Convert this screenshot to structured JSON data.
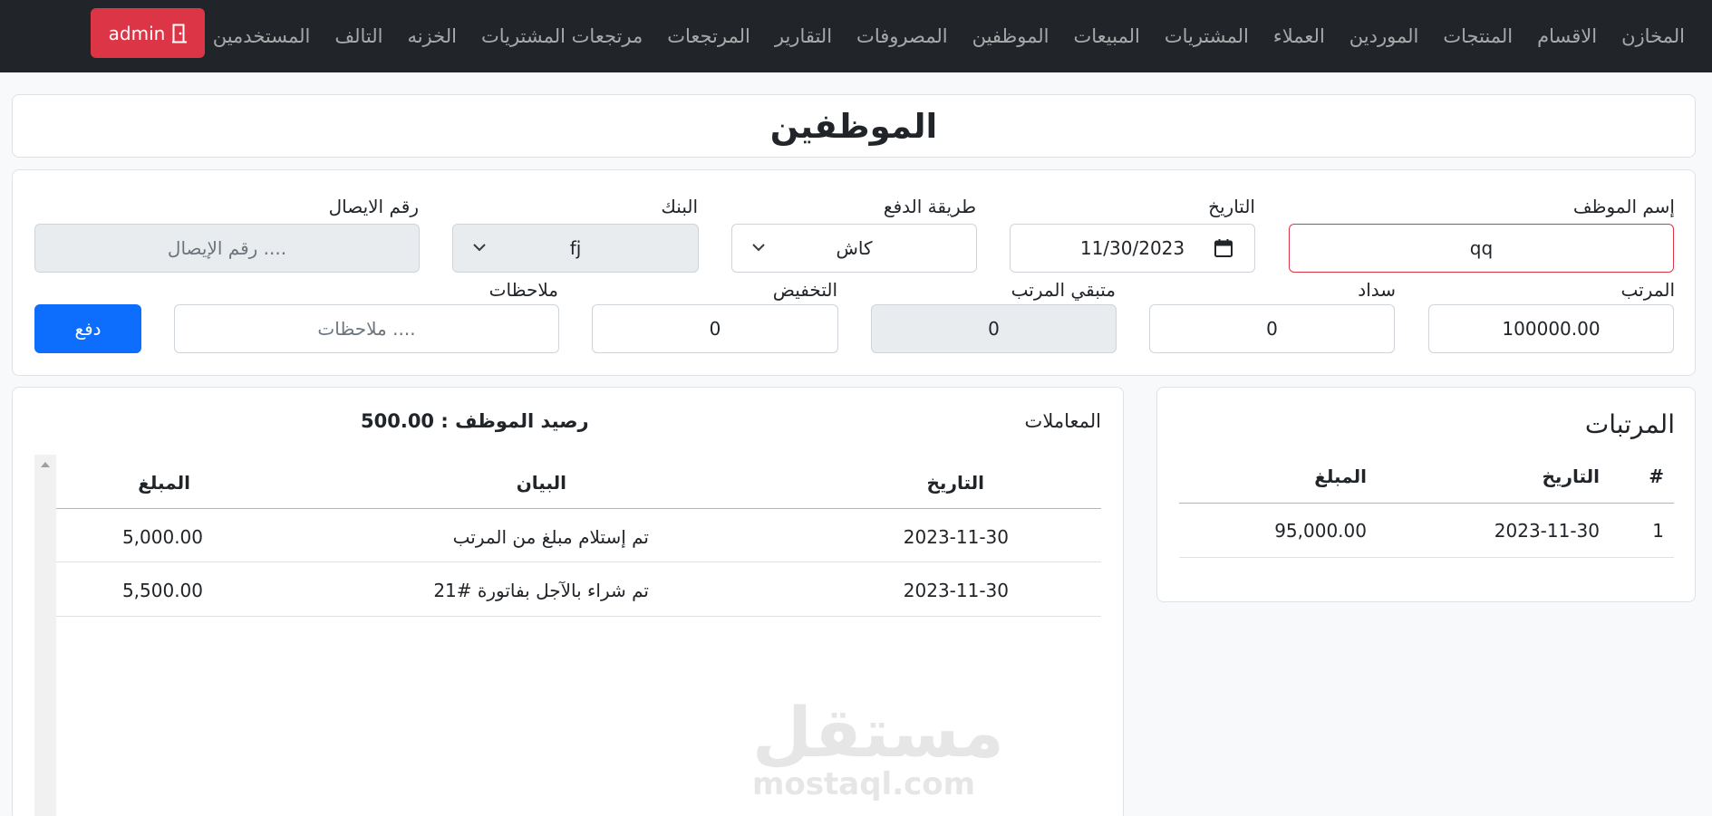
{
  "nav": {
    "items": [
      "المخازن",
      "الاقسام",
      "المنتجات",
      "الموردين",
      "العملاء",
      "المشتريات",
      "المبيعات",
      "الموظفين",
      "المصروفات",
      "التقارير",
      "المرتجعات",
      "مرتجعات المشتريات",
      "الخزنه",
      "التالف",
      "المستخدمين"
    ],
    "admin_label": "admin"
  },
  "page": {
    "title": "الموظفين"
  },
  "form": {
    "employee_name_label": "إسم الموظف",
    "employee_name_value": "qq",
    "date_label": "التاريخ",
    "date_value": "11/30/2023",
    "payment_method_label": "طريقة الدفع",
    "payment_method_value": "كاش",
    "bank_label": "البنك",
    "bank_value": "fj",
    "receipt_label": "رقم الايصال",
    "receipt_placeholder": "رقم الإيصال ....",
    "salary_label": "المرتب",
    "salary_value": "100000.00",
    "paid_label": "سداد",
    "paid_value": "0",
    "remaining_label": "متبقي المرتب",
    "remaining_value": "0",
    "discount_label": "التخفيض",
    "discount_value": "0",
    "notes_label": "ملاحظات",
    "notes_placeholder": "ملاحظات ....",
    "pay_button": "دفع"
  },
  "salaries": {
    "title": "المرتبات",
    "headers": [
      "#",
      "التاريخ",
      "المبلغ"
    ],
    "rows": [
      {
        "num": "1",
        "date": "2023-11-30",
        "amount": "95,000.00"
      }
    ]
  },
  "transactions": {
    "title": "المعاملات",
    "balance": "رصيد الموظف : 500.00",
    "headers": [
      "التاريخ",
      "البيان",
      "المبلغ"
    ],
    "rows": [
      {
        "date": "2023-11-30",
        "desc": "تم إستلام مبلغ من المرتب",
        "amount": "5,000.00"
      },
      {
        "date": "2023-11-30",
        "desc": "تم شراء بالآجل بفاتورة #21",
        "amount": "5,500.00"
      }
    ]
  },
  "watermark": {
    "arabic": "مستقل",
    "latin": "mostaql.com"
  },
  "colors": {
    "navbar": "#212529",
    "danger": "#dc3545",
    "primary": "#0d6efd"
  },
  "icons": {
    "admin": "door-exit-icon",
    "select": "chevron-down-icon",
    "date": "calendar-icon"
  }
}
